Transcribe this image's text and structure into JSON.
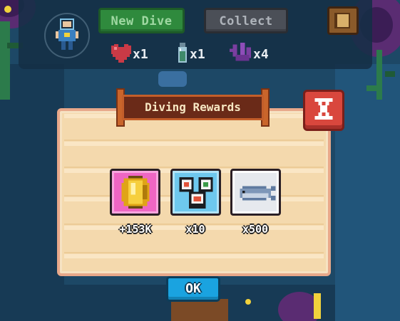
{
  "hud": {
    "new_dive_label": "New Dive",
    "collect_label": "Collect",
    "items": [
      {
        "icon": "heart-icon",
        "count": "x1"
      },
      {
        "icon": "potion-bottle-icon",
        "count": "x1"
      },
      {
        "icon": "coral-icon",
        "count": "x4"
      }
    ]
  },
  "dialog": {
    "title": "Diving Rewards",
    "rewards": [
      {
        "icon": "gold-coin-icon",
        "label": "+153K"
      },
      {
        "icon": "sushi-icon",
        "label": "x10"
      },
      {
        "icon": "sardine-fish-icon",
        "label": "x500"
      }
    ],
    "ok_label": "OK"
  },
  "colors": {
    "panel": "#f4d9ad",
    "title_board": "#6a2a18",
    "close_button": "#d9473d",
    "ok_button": "#1aa3e0",
    "new_dive_button": "#2f8a3d",
    "collect_button": "#4b4f57"
  }
}
